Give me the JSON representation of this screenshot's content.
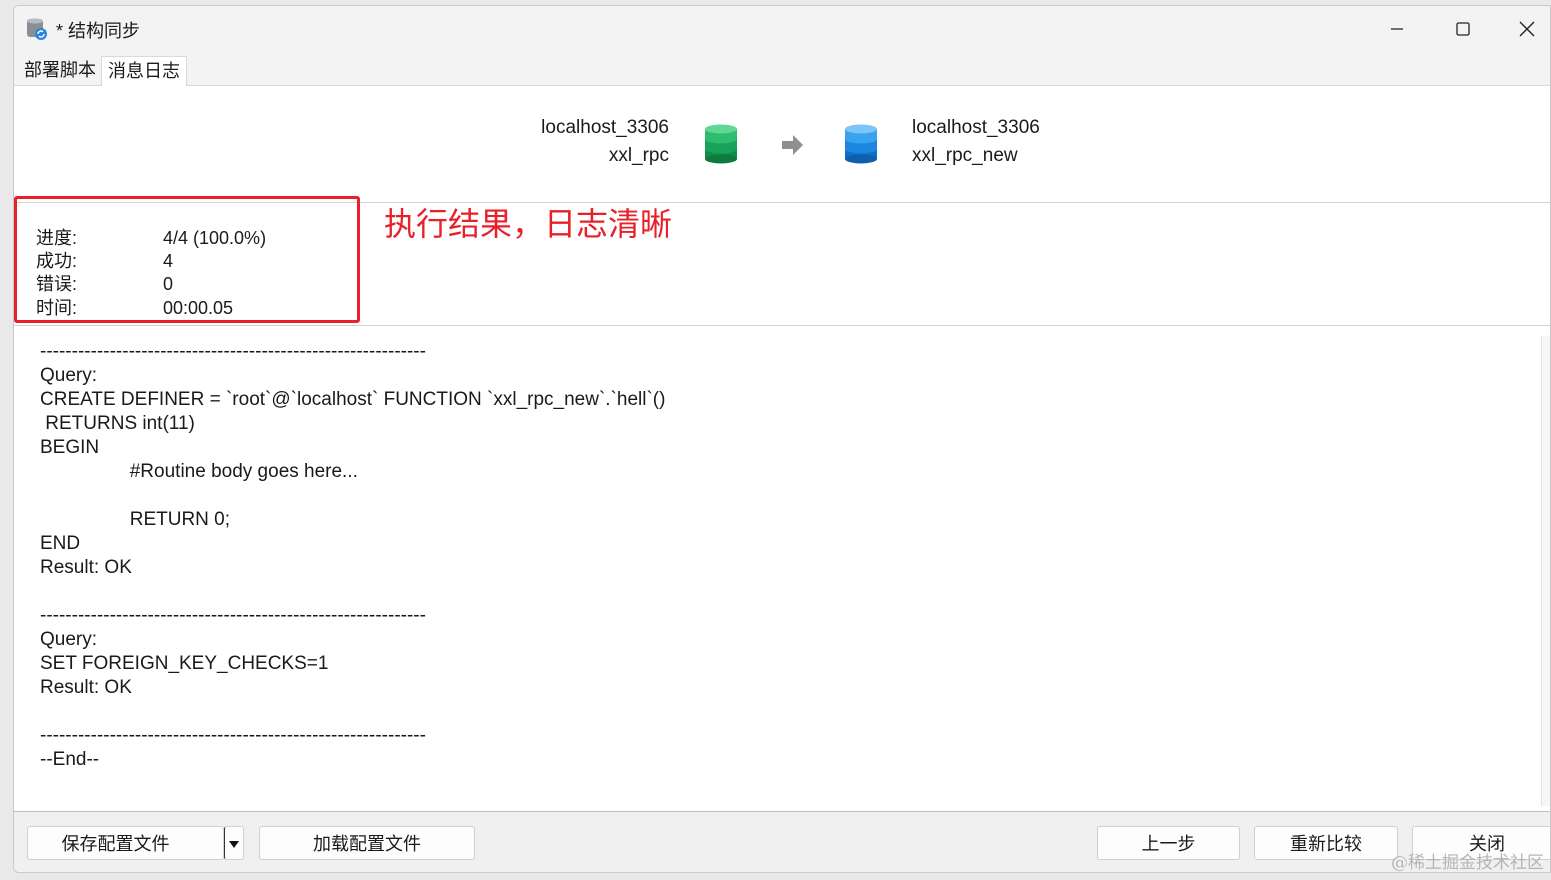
{
  "window": {
    "title": "* 结构同步"
  },
  "tabs": [
    {
      "label": "部署脚本",
      "active": false
    },
    {
      "label": "消息日志",
      "active": true
    }
  ],
  "connection": {
    "source": {
      "server": "localhost_3306",
      "database": "xxl_rpc",
      "color": "#1aa35a"
    },
    "target": {
      "server": "localhost_3306",
      "database": "xxl_rpc_new",
      "color": "#1f8fe0"
    }
  },
  "stats": {
    "progress_label": "进度:",
    "progress_value": "4/4 (100.0%)",
    "success_label": "成功:",
    "success_value": "4",
    "error_label": "错误:",
    "error_value": "0",
    "time_label": "时间:",
    "time_value": "00:00.05"
  },
  "annotation": {
    "text": "执行结果，日志清晰",
    "color": "#e8202a"
  },
  "log": {
    "lines": [
      "-------------------------------------------------------------",
      "Query:",
      "CREATE DEFINER = `root`@`localhost` FUNCTION `xxl_rpc_new`.`hell`()",
      " RETURNS int(11)",
      "BEGIN",
      "\t#Routine body goes here...",
      "",
      "\tRETURN 0;",
      "END",
      "Result: OK",
      "",
      "-------------------------------------------------------------",
      "Query:",
      "SET FOREIGN_KEY_CHECKS=1",
      "Result: OK",
      "",
      "-------------------------------------------------------------",
      "--End--"
    ]
  },
  "footer": {
    "save_config": "保存配置文件",
    "load_config": "加载配置文件",
    "prev_step": "上一步",
    "recompare": "重新比较",
    "close": "关闭"
  },
  "watermark": "@稀土掘金技术社区"
}
